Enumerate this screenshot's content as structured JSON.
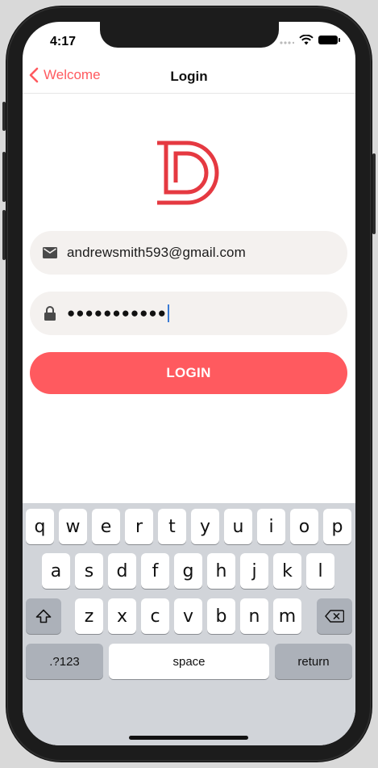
{
  "status_bar": {
    "time": "4:17"
  },
  "nav": {
    "back_label": "Welcome",
    "title": "Login"
  },
  "form": {
    "email_value": "andrewsmith593@gmail.com",
    "password_masked": "●●●●●●●●●●●",
    "login_label": "LOGIN"
  },
  "keyboard": {
    "row1": [
      "q",
      "w",
      "e",
      "r",
      "t",
      "y",
      "u",
      "i",
      "o",
      "p"
    ],
    "row2": [
      "a",
      "s",
      "d",
      "f",
      "g",
      "h",
      "j",
      "k",
      "l"
    ],
    "row3": [
      "z",
      "x",
      "c",
      "v",
      "b",
      "n",
      "m"
    ],
    "numbers_label": ".?123",
    "space_label": "space",
    "return_label": "return"
  },
  "colors": {
    "accent": "#ff5a5f",
    "field_bg": "#f4f1ef",
    "keyboard_bg": "#d1d4d9"
  }
}
